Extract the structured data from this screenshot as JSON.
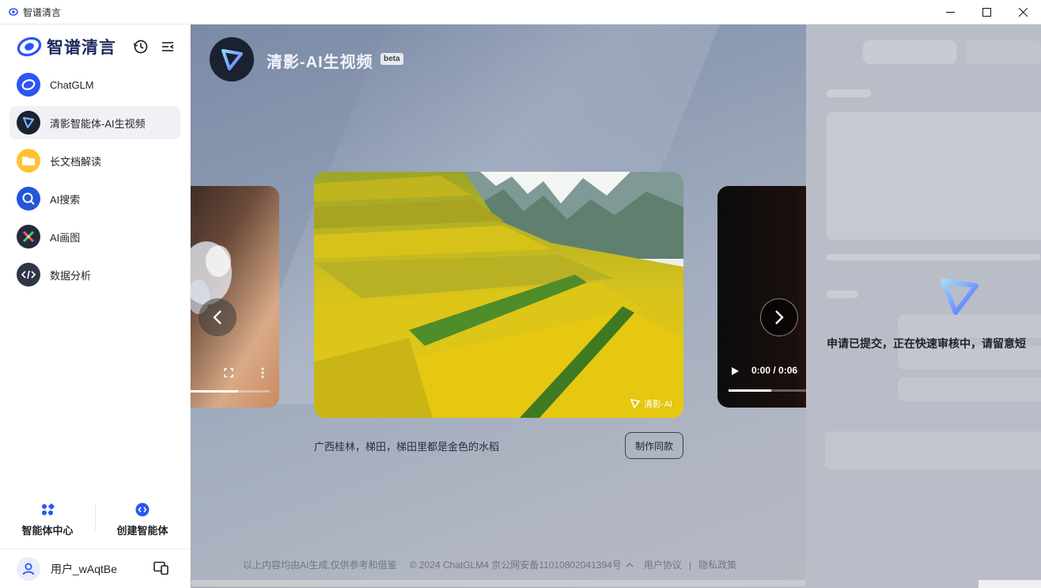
{
  "window": {
    "title": "智谱清言",
    "controls": [
      "minimize",
      "maximize",
      "close"
    ]
  },
  "sidebar": {
    "brand": "智谱清言",
    "tools": [
      "history-icon",
      "collapse-sidebar-icon"
    ],
    "items": [
      {
        "label": "ChatGLM",
        "icon": "chatglm-logo-icon",
        "active": false
      },
      {
        "label": "清影智能体-AI生视频",
        "icon": "qingying-play-icon",
        "active": true
      },
      {
        "label": "长文档解读",
        "icon": "folder-icon",
        "active": false
      },
      {
        "label": "AI搜索",
        "icon": "ai-search-icon",
        "active": false
      },
      {
        "label": "AI画图",
        "icon": "ai-draw-icon",
        "active": false
      },
      {
        "label": "数据分析",
        "icon": "code-icon",
        "active": false
      }
    ],
    "agent_center": "智能体中心",
    "create_agent": "创建智能体",
    "user": {
      "name": "用户_wAqtBe"
    }
  },
  "main": {
    "title": "清影-AI生视频",
    "badge": "beta",
    "center_card": {
      "caption": "广西桂林，梯田，梯田里都是金色的水稻",
      "watermark": "清影·AI",
      "make_button": "制作同款"
    },
    "right_card": {
      "time": "0:00 / 0:06",
      "progress": 0.45
    },
    "left_card": {
      "progress": 0.6
    },
    "footer": {
      "disclaimer": "以上内容均由AI生成,仅供参考和借鉴",
      "copyright": "© 2024 ChatGLM4 京公网安备11010802041394号",
      "terms": "用户协议",
      "separator": "|",
      "privacy": "隐私政策"
    }
  },
  "panel": {
    "notice": "申请已提交，正在快速审核中，请留意短"
  },
  "colors": {
    "accent": "#2b56f5",
    "brand_dark": "#1d2b5e",
    "main_bg": "#8c9ab2",
    "panel_bg": "#b9bdc7"
  }
}
